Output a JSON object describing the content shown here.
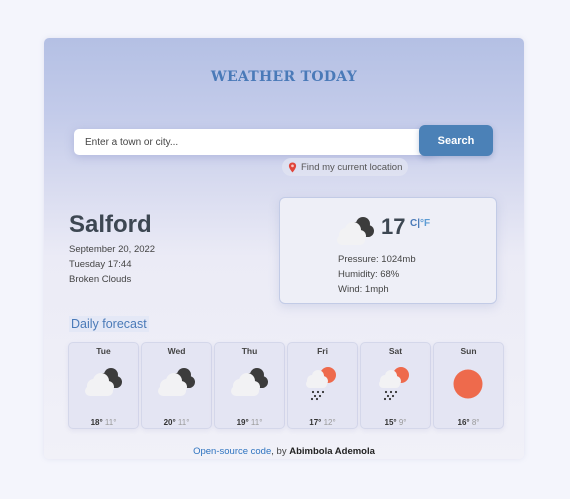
{
  "header": {
    "title": "WEATHER TODAY"
  },
  "search": {
    "placeholder": "Enter a town or city...",
    "button_label": "Search",
    "location_label": "Find my current location"
  },
  "city": {
    "name": "Salford",
    "date": "September 20, 2022",
    "day_time": "Tuesday 17:44",
    "description": "Broken Clouds"
  },
  "current": {
    "temperature": "17",
    "unit_c": "C",
    "separator": "|",
    "unit_f": "°F",
    "icon": "broken-clouds-icon",
    "pressure": "Pressure: 1024mb",
    "humidity": "Humidity: 68%",
    "wind": "Wind: 1mph"
  },
  "forecast": {
    "title": "Daily forecast",
    "days": [
      {
        "day": "Tue",
        "high": "18°",
        "low": "11°",
        "icon": "broken-clouds-icon"
      },
      {
        "day": "Wed",
        "high": "20°",
        "low": "11°",
        "icon": "broken-clouds-icon"
      },
      {
        "day": "Thu",
        "high": "19°",
        "low": "11°",
        "icon": "broken-clouds-icon"
      },
      {
        "day": "Fri",
        "high": "17°",
        "low": "12°",
        "icon": "sun-rain-icon"
      },
      {
        "day": "Sat",
        "high": "15°",
        "low": "9°",
        "icon": "sun-rain-icon"
      },
      {
        "day": "Sun",
        "high": "16°",
        "low": "8°",
        "icon": "sun-icon"
      }
    ]
  },
  "footer": {
    "link_text": "Open-source code",
    "by_text": ", by ",
    "author": "Abimbola Ademola"
  },
  "colors": {
    "accent": "#4b81b7",
    "title": "#4a7ab8",
    "sun": "#ee6a4c",
    "link": "#2f74c0"
  }
}
